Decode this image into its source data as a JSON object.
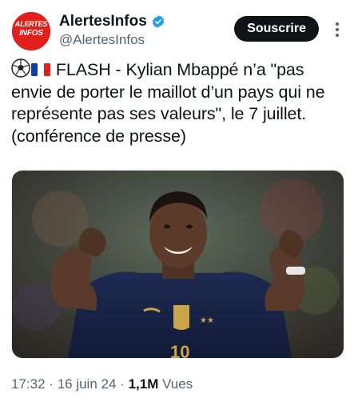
{
  "account": {
    "avatar_line1": "ALERTES",
    "avatar_line2": "INFOS",
    "display_name": "AlertesInfos",
    "handle": "@AlertesInfos",
    "verified_color": "#1d9bf0"
  },
  "actions": {
    "subscribe_label": "Souscrire",
    "more_icon": "more-vertical-icon"
  },
  "tweet": {
    "emojis": [
      "soccer-ball-icon",
      "france-flag-icon"
    ],
    "text": "FLASH - Kylian Mbappé n’a \"pas envie de porter le maillot d’un pays qui ne représente pas ses valeurs\", le 7 juillet. (conférence de presse)",
    "media_description_icon": "photo-image-icon"
  },
  "meta": {
    "time": "17:32",
    "separator": "·",
    "date": "16 juin 24",
    "views_count": "1,1M",
    "views_label": "Vues"
  },
  "colors": {
    "brand_red": "#e0201c",
    "button_bg": "#0f1419",
    "secondary_text": "#536471"
  }
}
